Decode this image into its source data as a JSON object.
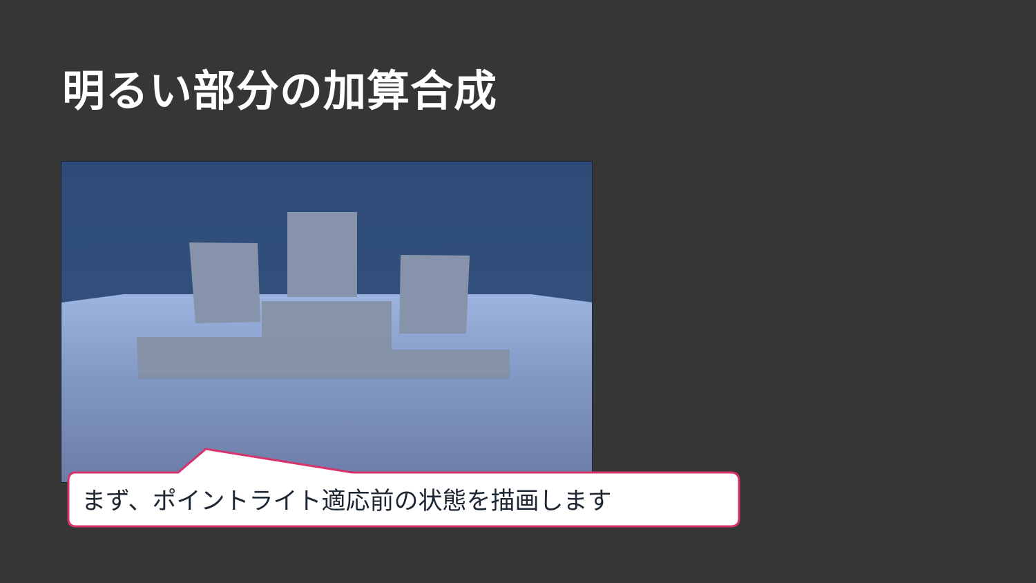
{
  "slide": {
    "title": "明るい部分の加算合成",
    "background_color": "#363636",
    "title_color": "#ffffff"
  },
  "scene_image": {
    "description_icon": "3d-scene-render",
    "sky_color": "#32507c",
    "ground_color_top": "#95acd8",
    "ground_color_bottom": "#6d7fa8",
    "box_color": "#8593a9"
  },
  "callout": {
    "text": "まず、ポイントライト適応前の状態を描画します",
    "border_color": "#d6336c",
    "fill_color": "#ffffff"
  }
}
